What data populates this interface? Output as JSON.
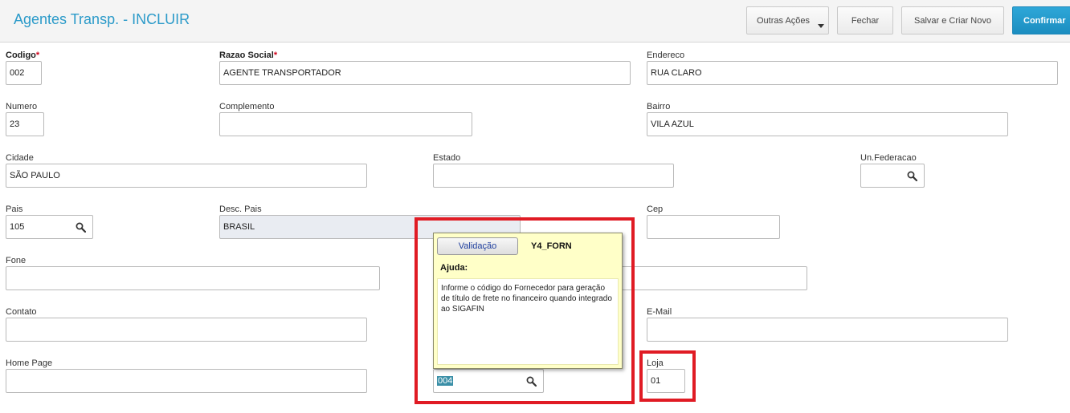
{
  "header": {
    "title": "Agentes Transp. - INCLUIR",
    "buttons": {
      "outras_acoes": "Outras Ações",
      "fechar": "Fechar",
      "salvar_criar_novo": "Salvar e Criar Novo",
      "confirmar": "Confirmar"
    }
  },
  "form": {
    "codigo": {
      "label": "Codigo",
      "required_mark": "*",
      "value": "002"
    },
    "razao_social": {
      "label": "Razao Social",
      "required_mark": "*",
      "value": "AGENTE TRANSPORTADOR"
    },
    "endereco": {
      "label": "Endereco",
      "value": "RUA CLARO"
    },
    "numero": {
      "label": "Numero",
      "value": "23"
    },
    "complemento": {
      "label": "Complemento",
      "value": ""
    },
    "bairro": {
      "label": "Bairro",
      "value": "VILA AZUL"
    },
    "cidade": {
      "label": "Cidade",
      "value": "SÃO PAULO"
    },
    "estado": {
      "label": "Estado",
      "value": ""
    },
    "un_federacao": {
      "label": "Un.Federacao",
      "value": ""
    },
    "pais": {
      "label": "Pais",
      "value": "105"
    },
    "desc_pais": {
      "label": "Desc. Pais",
      "value": "BRASIL"
    },
    "cep": {
      "label": "Cep",
      "value": ""
    },
    "fone": {
      "label": "Fone",
      "value": ""
    },
    "contato": {
      "label": "Contato",
      "value": ""
    },
    "email": {
      "label": "E-Mail",
      "value": ""
    },
    "home_page": {
      "label": "Home Page",
      "value": ""
    },
    "fornecedor": {
      "value": "004"
    },
    "loja": {
      "label": "Loja",
      "value": "01"
    }
  },
  "tooltip": {
    "button": "Validação",
    "field_code": "Y4_FORN",
    "ajuda_label": "Ajuda:",
    "help_text": "Informe o código do Fornecedor para geração de título de frete no financeiro quando integrado ao SIGAFIN"
  },
  "colors": {
    "title": "#2b9ac9",
    "confirm_button": "#1b8dc0",
    "highlight_border": "#e01b24",
    "tooltip_bg": "#ffffc8",
    "readonly_bg": "#e9ecf2"
  },
  "icons": {
    "lookup": "search-icon",
    "dropdown": "caret-down-icon"
  }
}
